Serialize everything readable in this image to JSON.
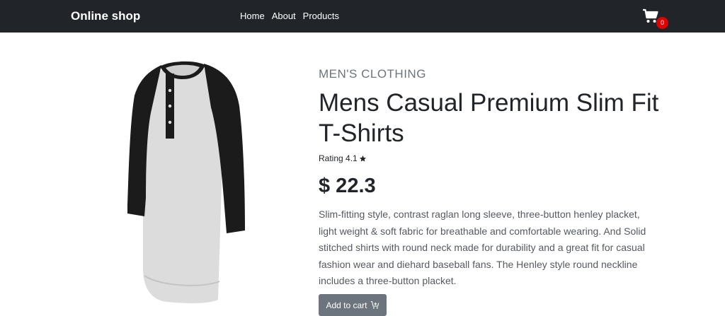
{
  "navbar": {
    "brand": "Online shop",
    "links": [
      "Home",
      "About",
      "Products"
    ],
    "cart": {
      "icon": "cart-icon",
      "count": "0"
    }
  },
  "product": {
    "image_icon": "henley-shirt-image",
    "category": "MEN'S CLOTHING",
    "title": "Mens Casual Premium Slim Fit T-Shirts",
    "rating_label": "Rating 4.1",
    "rating_icon": "star-icon",
    "price": "$ 22.3",
    "description": "Slim-fitting style, contrast raglan long sleeve, three-button henley placket, light weight & soft fabric for breathable and comfortable wearing. And Solid stitched shirts with round neck made for durability and a great fit for casual fashion wear and diehard baseball fans. The Henley style round neckline includes a three-button placket.",
    "add_to_cart_label": "Add to cart",
    "add_to_cart_icon": "cart-plus-icon"
  },
  "colors": {
    "navbar_bg": "#212529",
    "badge": "#e00000",
    "button_bg": "#6c757d",
    "category_text": "#6c757d"
  }
}
